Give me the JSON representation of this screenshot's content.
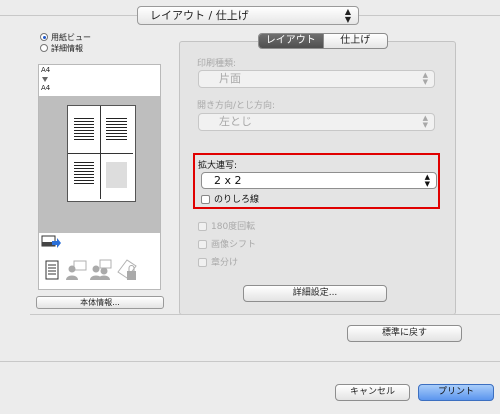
{
  "top_popup": {
    "value": "レイアウト / 仕上げ"
  },
  "view_radios": [
    {
      "label": "用紙ビュー",
      "selected": true
    },
    {
      "label": "詳細情報",
      "selected": false
    }
  ],
  "preview": {
    "paper_top": "A4",
    "paper_bottom": "A4"
  },
  "printer_info_button": "本体情報...",
  "tabs": [
    {
      "label": "レイアウト",
      "active": true
    },
    {
      "label": "仕上げ",
      "active": false
    }
  ],
  "print_type": {
    "label": "印刷種類:",
    "value": "片面"
  },
  "binding": {
    "label": "開き方向/とじ方向:",
    "value": "左とじ"
  },
  "multi_page": {
    "label": "拡大連写:",
    "value": "2 x 2",
    "margin_line_label": "のりしろ線",
    "margin_line_checked": false
  },
  "options": [
    {
      "label": "180度回転",
      "checked": false
    },
    {
      "label": "画像シフト",
      "checked": false
    },
    {
      "label": "章分け",
      "checked": false
    }
  ],
  "detail_button": "詳細設定...",
  "reset_button": "標準に戻す",
  "cancel_button": "キャンセル",
  "print_button": "プリント",
  "colors": {
    "highlight": "#e00000",
    "accent": "#5b95ee"
  }
}
